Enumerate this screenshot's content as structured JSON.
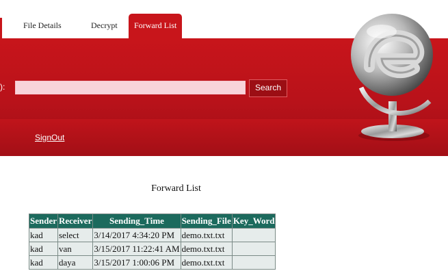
{
  "nav": {
    "tabs": [
      {
        "label": "File Details"
      },
      {
        "label": "Decrypt"
      },
      {
        "label": "Forward List"
      }
    ]
  },
  "search": {
    "label_fragment": "):",
    "value": "",
    "button_label": "Search"
  },
  "signout_label": "SignOut",
  "page_title": "Forward List",
  "table": {
    "headers": [
      "Sender",
      "Receiver",
      "Sending_Time",
      "Sending_File",
      "Key_Word"
    ],
    "rows": [
      [
        "kad",
        "select",
        "3/14/2017 4:34:20 PM",
        "demo.txt.txt",
        ""
      ],
      [
        "kad",
        "van",
        "3/15/2017 11:22:41 AM",
        "demo.txt.txt",
        ""
      ],
      [
        "kad",
        "daya",
        "3/15/2017 1:00:06 PM",
        "demo.txt.txt",
        ""
      ]
    ]
  },
  "colors": {
    "header_red": "#c8151b",
    "table_header": "#1c6a5d",
    "table_cell": "#e6eceb"
  }
}
